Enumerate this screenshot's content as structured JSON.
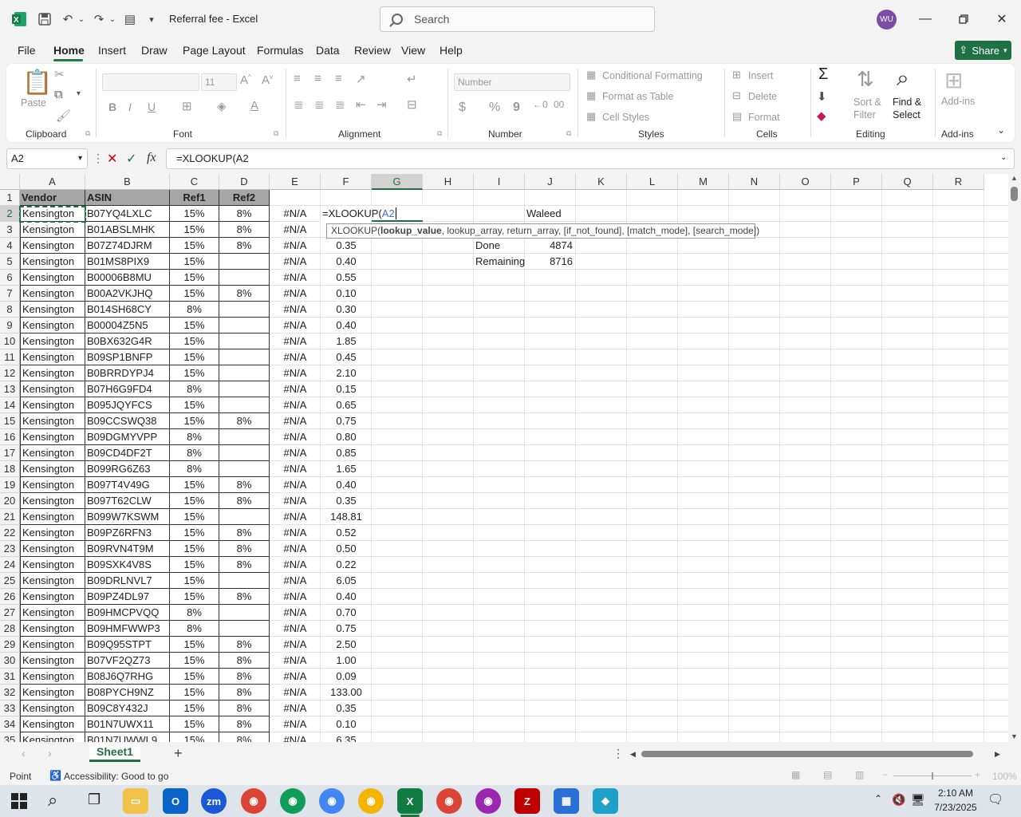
{
  "titlebar": {
    "doc_title": "Referral fee - Excel",
    "search_placeholder": "Search",
    "avatar_initials": "WU",
    "icons": [
      "excel-logo-icon",
      "save-icon",
      "undo-icon",
      "redo-icon",
      "customize-qat-icon",
      "minimize-icon",
      "restore-icon",
      "close-icon"
    ]
  },
  "tabs": [
    "File",
    "Home",
    "Insert",
    "Draw",
    "Page Layout",
    "Formulas",
    "Data",
    "Review",
    "View",
    "Help"
  ],
  "active_tab": "Home",
  "share_label": "Share",
  "ribbon": {
    "clipboard": {
      "label": "Clipboard",
      "paste": "Paste"
    },
    "font": {
      "label": "Font",
      "font_size": "11",
      "bold": "B",
      "italic": "I",
      "underline": "U"
    },
    "alignment": {
      "label": "Alignment"
    },
    "number": {
      "label": "Number",
      "format": "Number",
      "currency": "$",
      "percent": "%",
      "comma": "9"
    },
    "styles": {
      "label": "Styles",
      "conditional": "Conditional Formatting",
      "format_table": "Format as Table",
      "cell_styles": "Cell Styles"
    },
    "cells": {
      "label": "Cells",
      "insert": "Insert",
      "delete": "Delete",
      "format": "Format"
    },
    "editing": {
      "label": "Editing",
      "sum_symbol": "Σ",
      "sort_filter": "Sort & Filter",
      "find_select": "Find & Select"
    },
    "addins": {
      "label": "Add-ins",
      "addins": "Add-ins"
    }
  },
  "formula_bar": {
    "name_box": "A2",
    "fx": "fx",
    "formula": "=XLOOKUP(A2"
  },
  "columns": [
    "A",
    "B",
    "C",
    "D",
    "E",
    "F",
    "G",
    "H",
    "I",
    "J",
    "K",
    "L",
    "M",
    "N",
    "O",
    "P",
    "Q",
    "R"
  ],
  "header_row": {
    "a": "Vendor",
    "b": "ASIN",
    "c": "Ref1",
    "d": "Ref2"
  },
  "rows": [
    {
      "n": "2",
      "a": "Kensington",
      "b": "B07YQ4LXLC",
      "c": "15%",
      "d": "8%",
      "e": "#N/A",
      "f": "=XLOOKUP(A2"
    },
    {
      "n": "3",
      "a": "Kensington",
      "b": "B01ABSLMHK",
      "c": "15%",
      "d": "8%",
      "e": "#N/A",
      "f": ""
    },
    {
      "n": "4",
      "a": "Kensington",
      "b": "B07Z74DJRM",
      "c": "15%",
      "d": "8%",
      "e": "#N/A",
      "f": "0.35"
    },
    {
      "n": "5",
      "a": "Kensington",
      "b": "B01MS8PIX9",
      "c": "15%",
      "d": "",
      "e": "#N/A",
      "f": "0.40"
    },
    {
      "n": "6",
      "a": "Kensington",
      "b": "B00006B8MU",
      "c": "15%",
      "d": "",
      "e": "#N/A",
      "f": "0.55"
    },
    {
      "n": "7",
      "a": "Kensington",
      "b": "B00A2VKJHQ",
      "c": "15%",
      "d": "8%",
      "e": "#N/A",
      "f": "0.10"
    },
    {
      "n": "8",
      "a": "Kensington",
      "b": "B014SH68CY",
      "c": "8%",
      "d": "",
      "e": "#N/A",
      "f": "0.30"
    },
    {
      "n": "9",
      "a": "Kensington",
      "b": "B00004Z5N5",
      "c": "15%",
      "d": "",
      "e": "#N/A",
      "f": "0.40"
    },
    {
      "n": "10",
      "a": "Kensington",
      "b": "B0BX632G4R",
      "c": "15%",
      "d": "",
      "e": "#N/A",
      "f": "1.85"
    },
    {
      "n": "11",
      "a": "Kensington",
      "b": "B09SP1BNFP",
      "c": "15%",
      "d": "",
      "e": "#N/A",
      "f": "0.45"
    },
    {
      "n": "12",
      "a": "Kensington",
      "b": "B0BRRDYPJ4",
      "c": "15%",
      "d": "",
      "e": "#N/A",
      "f": "2.10"
    },
    {
      "n": "13",
      "a": "Kensington",
      "b": "B07H6G9FD4",
      "c": "8%",
      "d": "",
      "e": "#N/A",
      "f": "0.15"
    },
    {
      "n": "14",
      "a": "Kensington",
      "b": "B095JQYFCS",
      "c": "15%",
      "d": "",
      "e": "#N/A",
      "f": "0.65"
    },
    {
      "n": "15",
      "a": "Kensington",
      "b": "B09CCSWQ38",
      "c": "15%",
      "d": "8%",
      "e": "#N/A",
      "f": "0.75"
    },
    {
      "n": "16",
      "a": "Kensington",
      "b": "B09DGMYVPP",
      "c": "8%",
      "d": "",
      "e": "#N/A",
      "f": "0.80"
    },
    {
      "n": "17",
      "a": "Kensington",
      "b": "B09CD4DF2T",
      "c": "8%",
      "d": "",
      "e": "#N/A",
      "f": "0.85"
    },
    {
      "n": "18",
      "a": "Kensington",
      "b": "B099RG6Z63",
      "c": "8%",
      "d": "",
      "e": "#N/A",
      "f": "1.65"
    },
    {
      "n": "19",
      "a": "Kensington",
      "b": "B097T4V49G",
      "c": "15%",
      "d": "8%",
      "e": "#N/A",
      "f": "0.40"
    },
    {
      "n": "20",
      "a": "Kensington",
      "b": "B097T62CLW",
      "c": "15%",
      "d": "8%",
      "e": "#N/A",
      "f": "0.35"
    },
    {
      "n": "21",
      "a": "Kensington",
      "b": "B099W7KSWM",
      "c": "15%",
      "d": "",
      "e": "#N/A",
      "f": "148.81"
    },
    {
      "n": "22",
      "a": "Kensington",
      "b": "B09PZ6RFN3",
      "c": "15%",
      "d": "8%",
      "e": "#N/A",
      "f": "0.52"
    },
    {
      "n": "23",
      "a": "Kensington",
      "b": "B09RVN4T9M",
      "c": "15%",
      "d": "8%",
      "e": "#N/A",
      "f": "0.50"
    },
    {
      "n": "24",
      "a": "Kensington",
      "b": "B09SXK4V8S",
      "c": "15%",
      "d": "8%",
      "e": "#N/A",
      "f": "0.22"
    },
    {
      "n": "25",
      "a": "Kensington",
      "b": "B09DRLNVL7",
      "c": "15%",
      "d": "",
      "e": "#N/A",
      "f": "6.05"
    },
    {
      "n": "26",
      "a": "Kensington",
      "b": "B09PZ4DL97",
      "c": "15%",
      "d": "8%",
      "e": "#N/A",
      "f": "0.40"
    },
    {
      "n": "27",
      "a": "Kensington",
      "b": "B09HMCPVQQ",
      "c": "8%",
      "d": "",
      "e": "#N/A",
      "f": "0.70"
    },
    {
      "n": "28",
      "a": "Kensington",
      "b": "B09HMFWWP3",
      "c": "8%",
      "d": "",
      "e": "#N/A",
      "f": "0.75"
    },
    {
      "n": "29",
      "a": "Kensington",
      "b": "B09Q95STPT",
      "c": "15%",
      "d": "8%",
      "e": "#N/A",
      "f": "2.50"
    },
    {
      "n": "30",
      "a": "Kensington",
      "b": "B07VF2QZ73",
      "c": "15%",
      "d": "8%",
      "e": "#N/A",
      "f": "1.00"
    },
    {
      "n": "31",
      "a": "Kensington",
      "b": "B08J6Q7RHG",
      "c": "15%",
      "d": "8%",
      "e": "#N/A",
      "f": "0.09"
    },
    {
      "n": "32",
      "a": "Kensington",
      "b": "B08PYCH9NZ",
      "c": "15%",
      "d": "8%",
      "e": "#N/A",
      "f": "133.00"
    },
    {
      "n": "33",
      "a": "Kensington",
      "b": "B09C8Y432J",
      "c": "15%",
      "d": "8%",
      "e": "#N/A",
      "f": "0.35"
    },
    {
      "n": "34",
      "a": "Kensington",
      "b": "B01N7UWX11",
      "c": "15%",
      "d": "8%",
      "e": "#N/A",
      "f": "0.10"
    },
    {
      "n": "35",
      "a": "Kensington",
      "b": "B01N7UWWL9",
      "c": "15%",
      "d": "8%",
      "e": "#N/A",
      "f": "6.35"
    }
  ],
  "side_cells": {
    "j2": "Waleed",
    "i4": "Done",
    "j4": "4874",
    "i5": "Remaining",
    "j5": "8716"
  },
  "tooltip": {
    "fn": "XLOOKUP(",
    "arg1": "lookup_value",
    "rest": ", lookup_array, return_array, [if_not_found], [match_mode], [search_mode])"
  },
  "sheet_tab": "Sheet1",
  "status": {
    "mode": "Point",
    "accessibility": "Accessibility: Good to go",
    "zoom": "100%"
  },
  "taskbar": {
    "time": "2:10 AM",
    "date": "7/23/2025"
  },
  "colors": {
    "excel_green": "#1e7145",
    "header_fill": "#a6a6a6",
    "avatar": "#7b4ea6"
  }
}
